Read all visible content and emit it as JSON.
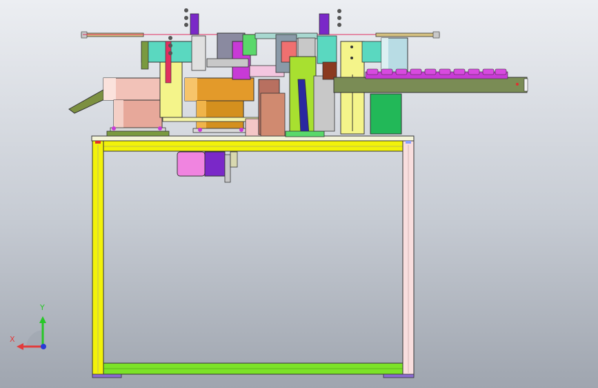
{
  "viewport": {
    "background_top": "#eceef2",
    "background_bottom": "#9fa5af"
  },
  "triad": {
    "y_label": "Y",
    "x_label": "X",
    "y_color": "#27c727",
    "x_color": "#e23b3b",
    "z_color": "#2a3bd6"
  },
  "colors": {
    "frame_yellow": "#f2f20a",
    "frame_pink": "#f9dede",
    "rail_green": "#7ce228",
    "bowl_copper": "#e39a2a",
    "bowl_pink": "#e7a89a",
    "conveyor": "#7a8c55",
    "magenta_parts": "#c83ad6",
    "motor_pink": "#f084e0",
    "motor_purple": "#7a28c8"
  }
}
